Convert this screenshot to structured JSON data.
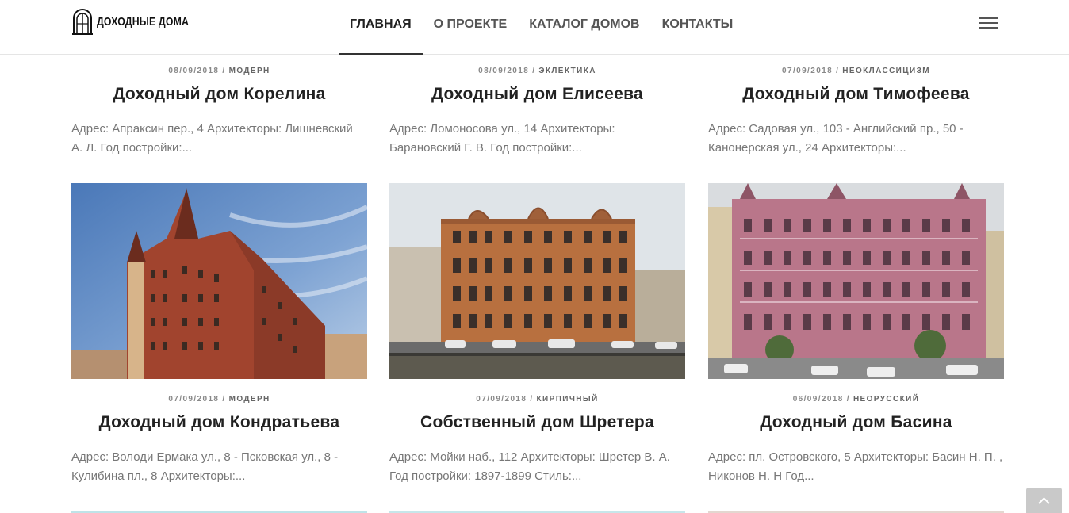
{
  "header": {
    "logo_text": "ДОХОДНЫЕ ДОМА",
    "nav": [
      {
        "label": "ГЛАВНАЯ",
        "active": true
      },
      {
        "label": "О ПРОЕКТЕ"
      },
      {
        "label": "КАТАЛОГ ДОМОВ"
      },
      {
        "label": "КОНТАКТЫ"
      }
    ]
  },
  "posts_row1": [
    {
      "date": "08/09/2018",
      "category": "МОДЕРН",
      "title": "Доходный дом Корелина",
      "excerpt": "Адрес: Апраксин пер., 4 Архитекторы: Лишневский А. Л. Год постройки:..."
    },
    {
      "date": "08/09/2018",
      "category": "ЭКЛЕКТИКА",
      "title": "Доходный дом Елисеева",
      "excerpt": "Адрес: Ломоносова ул., 14 Архитекторы: Барановский Г. В. Год постройки:..."
    },
    {
      "date": "07/09/2018",
      "category": "НЕОКЛАССИЦИЗМ",
      "title": "Доходный дом Тимофеева",
      "excerpt": "Адрес: Садовая ул., 103 - Английский пр., 50 - Канонерская ул., 24 Архитекторы:..."
    }
  ],
  "posts_row2": [
    {
      "date": "07/09/2018",
      "category": "МОДЕРН",
      "title": "Доходный дом Кондратьева",
      "excerpt": "Адрес: Володи Ермака ул., 8 - Псковская ул., 8 - Кулибина пл., 8 Архитекторы:..."
    },
    {
      "date": "07/09/2018",
      "category": "КИРПИЧНЫЙ",
      "title": "Собственный дом Шретера",
      "excerpt": "Адрес: Мойки наб., 112 Архитекторы: Шретер В. А. Год постройки: 1897-1899 Стиль:..."
    },
    {
      "date": "06/09/2018",
      "category": "НЕОРУССКИЙ",
      "title": "Доходный дом Басина",
      "excerpt": "Адрес: пл. Островского, 5 Архитекторы: Басин Н. П. , Никонов Н. Н Год..."
    }
  ],
  "separator": "/",
  "colors": {
    "accent": "#222222",
    "muted": "#777777",
    "scroll_top_bg": "#c9c9c9"
  },
  "icons": {
    "menu": "hamburger-icon",
    "scroll_top": "chevron-up-icon"
  }
}
